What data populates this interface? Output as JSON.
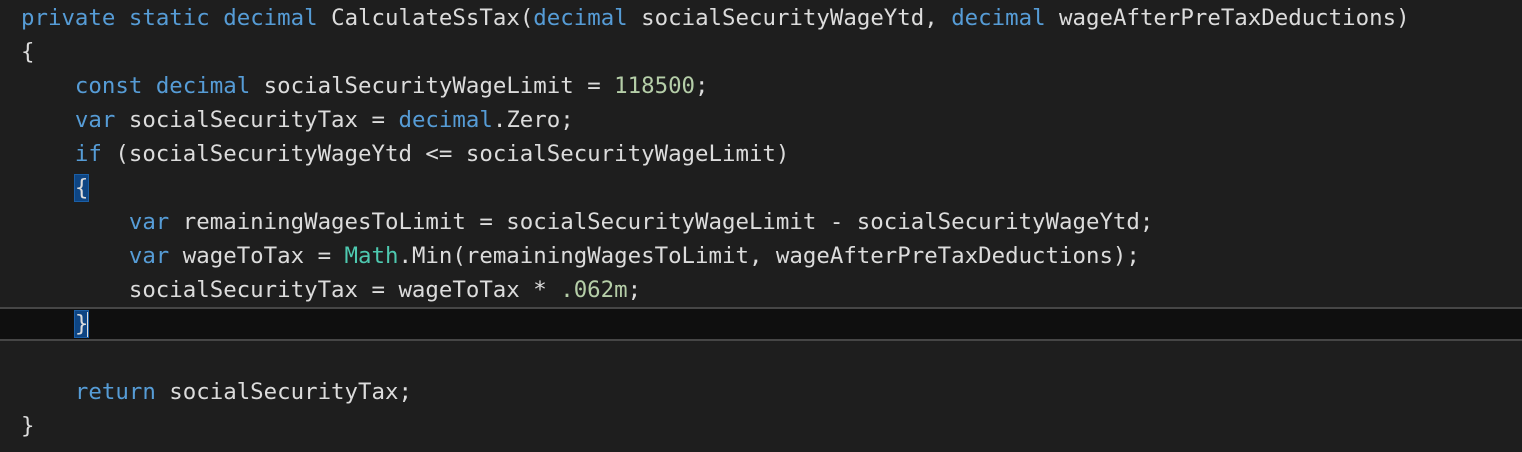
{
  "editor": {
    "language": "csharp",
    "theme": "dark",
    "colors": {
      "background": "#1e1e1e",
      "keyword": "#569cd6",
      "type": "#4ec9b0",
      "number": "#b5cea8",
      "text": "#dcdcdc",
      "current_line": "#0f0f0f",
      "brace_highlight": "#0e4583"
    },
    "current_line_number": 10,
    "lines": [
      {
        "tokens": [
          {
            "t": "private",
            "k": "kw"
          },
          {
            "t": " ",
            "k": "plain"
          },
          {
            "t": "static",
            "k": "kw"
          },
          {
            "t": " ",
            "k": "plain"
          },
          {
            "t": "decimal",
            "k": "kw"
          },
          {
            "t": " CalculateSsTax(",
            "k": "plain"
          },
          {
            "t": "decimal",
            "k": "kw"
          },
          {
            "t": " socialSecurityWageYtd, ",
            "k": "plain"
          },
          {
            "t": "decimal",
            "k": "kw"
          },
          {
            "t": " wageAfterPreTaxDeductions)",
            "k": "plain"
          }
        ]
      },
      {
        "tokens": [
          {
            "t": "{",
            "k": "plain"
          }
        ]
      },
      {
        "tokens": [
          {
            "t": "    ",
            "k": "plain"
          },
          {
            "t": "const",
            "k": "kw"
          },
          {
            "t": " ",
            "k": "plain"
          },
          {
            "t": "decimal",
            "k": "kw"
          },
          {
            "t": " socialSecurityWageLimit = ",
            "k": "plain"
          },
          {
            "t": "118500",
            "k": "num"
          },
          {
            "t": ";",
            "k": "plain"
          }
        ]
      },
      {
        "tokens": [
          {
            "t": "    ",
            "k": "plain"
          },
          {
            "t": "var",
            "k": "kw"
          },
          {
            "t": " socialSecurityTax = ",
            "k": "plain"
          },
          {
            "t": "decimal",
            "k": "kw"
          },
          {
            "t": ".Zero;",
            "k": "plain"
          }
        ]
      },
      {
        "tokens": [
          {
            "t": "    ",
            "k": "plain"
          },
          {
            "t": "if",
            "k": "kw"
          },
          {
            "t": " (socialSecurityWageYtd <= socialSecurityWageLimit)",
            "k": "plain"
          }
        ]
      },
      {
        "tokens": [
          {
            "t": "    ",
            "k": "plain"
          },
          {
            "t": "{",
            "k": "brace"
          }
        ]
      },
      {
        "tokens": [
          {
            "t": "        ",
            "k": "plain"
          },
          {
            "t": "var",
            "k": "kw"
          },
          {
            "t": " remainingWagesToLimit = socialSecurityWageLimit - socialSecurityWageYtd;",
            "k": "plain"
          }
        ]
      },
      {
        "tokens": [
          {
            "t": "        ",
            "k": "plain"
          },
          {
            "t": "var",
            "k": "kw"
          },
          {
            "t": " wageToTax = ",
            "k": "plain"
          },
          {
            "t": "Math",
            "k": "type"
          },
          {
            "t": ".Min(remainingWagesToLimit, wageAfterPreTaxDeductions);",
            "k": "plain"
          }
        ]
      },
      {
        "tokens": [
          {
            "t": "        ",
            "k": "plain"
          },
          {
            "t": "socialSecurityTax = wageToTax * ",
            "k": "plain"
          },
          {
            "t": ".062m",
            "k": "num"
          },
          {
            "t": ";",
            "k": "plain"
          }
        ]
      },
      {
        "tokens": [
          {
            "t": "    ",
            "k": "plain"
          },
          {
            "t": "}",
            "k": "brace"
          }
        ],
        "caret_after": true
      },
      {
        "tokens": []
      },
      {
        "tokens": [
          {
            "t": "    ",
            "k": "plain"
          },
          {
            "t": "return",
            "k": "kw"
          },
          {
            "t": " socialSecurityTax;",
            "k": "plain"
          }
        ]
      },
      {
        "tokens": [
          {
            "t": "}",
            "k": "plain"
          }
        ]
      }
    ]
  }
}
